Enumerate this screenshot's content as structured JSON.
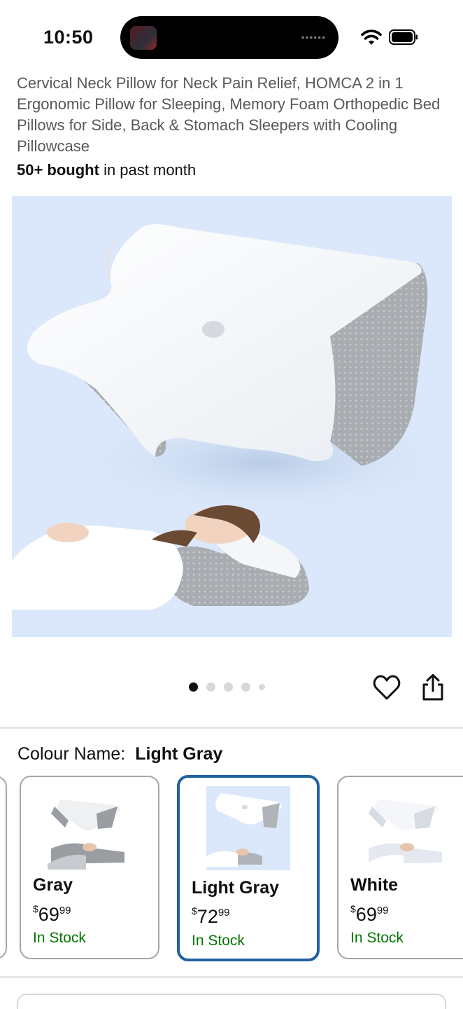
{
  "status_bar": {
    "time": "10:50",
    "wifi_icon": "wifi-icon",
    "battery_icon": "battery-icon"
  },
  "product": {
    "title": "Cervical Neck Pillow for Neck Pain Relief, HOMCA 2 in 1 Ergonomic Pillow for Sleeping, Memory Foam Orthopedic Bed Pillows for Side, Back & Stomach Sleepers with Cooling Pillowcase",
    "bought_bold": "50+ bought",
    "bought_rest": " in past month"
  },
  "gallery": {
    "image_count": 5,
    "active_index": 0,
    "wishlist_icon": "heart-icon",
    "share_icon": "share-icon"
  },
  "colour": {
    "label": "Colour Name:",
    "selected": "Light Gray",
    "options": [
      {
        "name": "Gray",
        "currency": "$",
        "whole": "69",
        "cents": "99",
        "stock": "In Stock"
      },
      {
        "name": "Light Gray",
        "currency": "$",
        "whole": "72",
        "cents": "99",
        "stock": "In Stock"
      },
      {
        "name": "White",
        "currency": "$",
        "whole": "69",
        "cents": "99",
        "stock": "In Stock"
      }
    ]
  },
  "colors": {
    "stock_green": "#007600",
    "selected_border": "#2162a1",
    "hero_bg": "#dbe8fb"
  }
}
